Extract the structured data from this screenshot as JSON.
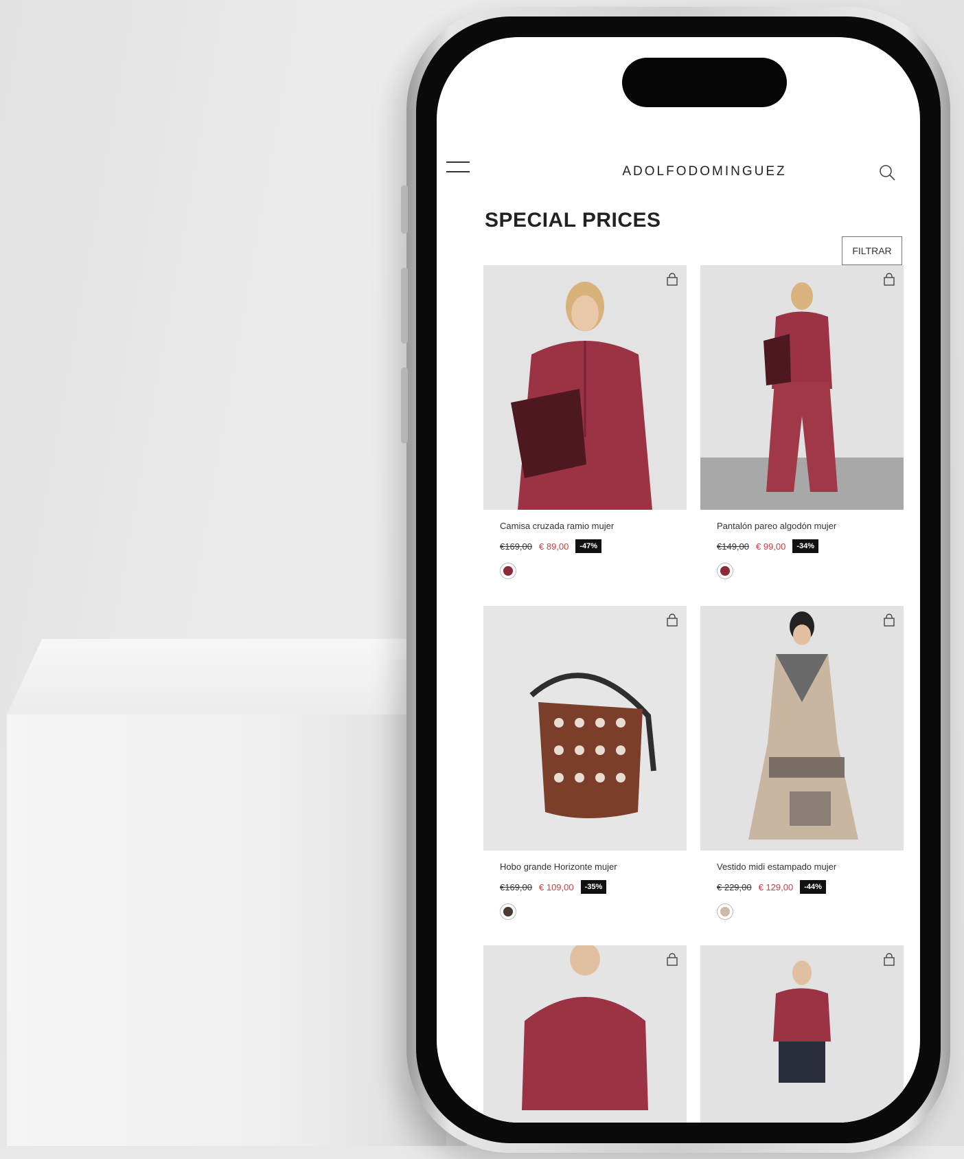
{
  "header": {
    "brand": "ADOLFODOMINGUEZ"
  },
  "page": {
    "title": "SPECIAL PRICES",
    "filter_label": "FILTRAR"
  },
  "products": [
    {
      "name": "Camisa cruzada ramio mujer",
      "old_price": "€169,00",
      "new_price": "€ 89,00",
      "discount": "-47%",
      "swatch_color": "#8c2a3a"
    },
    {
      "name": "Pantalón pareo algodón mujer",
      "old_price": "€149,00",
      "new_price": "€ 99,00",
      "discount": "-34%",
      "swatch_color": "#8c2a3a"
    },
    {
      "name": "Hobo grande Horizonte mujer",
      "old_price": "€169,00",
      "new_price": "€ 109,00",
      "discount": "-35%",
      "swatch_color": "#4a3a32"
    },
    {
      "name": "Vestido midi estampado mujer",
      "old_price": "€ 229,00",
      "new_price": "€ 129,00",
      "discount": "-44%",
      "swatch_color": "#cbbba6"
    },
    {
      "name": "",
      "old_price": "",
      "new_price": "",
      "discount": "",
      "swatch_color": ""
    },
    {
      "name": "",
      "old_price": "",
      "new_price": "",
      "discount": "",
      "swatch_color": ""
    }
  ],
  "colors": {
    "sale_red": "#d23c3c",
    "wine": "#9b3344"
  }
}
